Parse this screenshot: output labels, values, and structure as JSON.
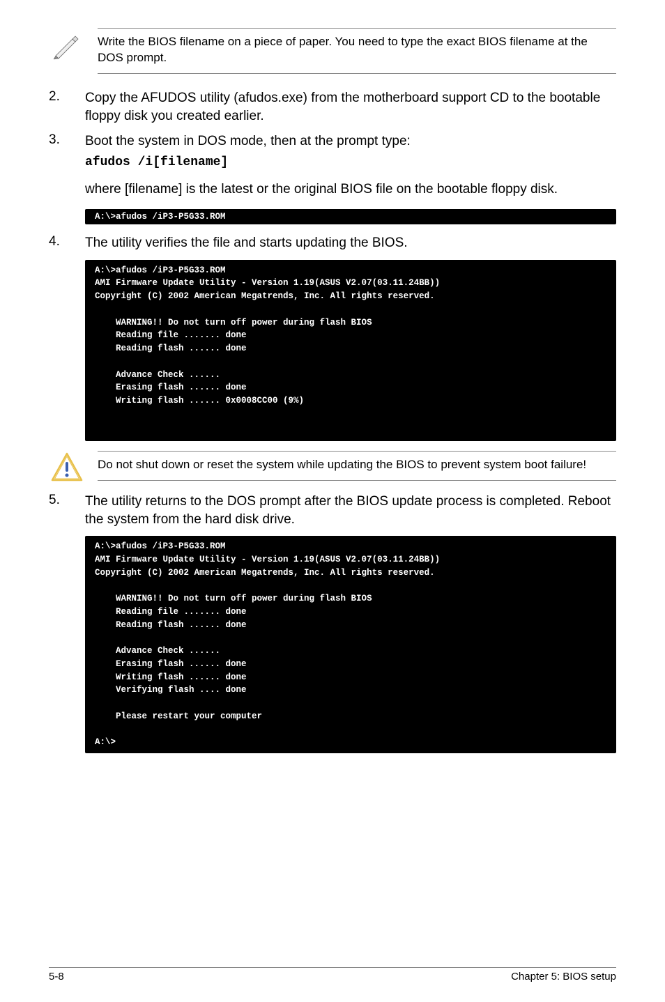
{
  "note1": "Write the BIOS filename on a piece of paper. You need to type the exact BIOS filename at the DOS prompt.",
  "steps": {
    "s2": {
      "num": "2.",
      "text": "Copy the AFUDOS utility (afudos.exe) from the motherboard support CD to the bootable floppy disk you created earlier."
    },
    "s3": {
      "num": "3.",
      "text": "Boot the system in DOS mode, then at the prompt type:",
      "code": "afudos /i[filename]"
    },
    "s4": {
      "num": "4.",
      "text": "The utility verifies the file and starts updating the BIOS."
    },
    "s5": {
      "num": "5.",
      "text": "The utility returns to the DOS prompt after the BIOS update process is completed. Reboot the system from the hard disk drive."
    }
  },
  "para1": "where [filename] is the latest or the original BIOS file on the bootable floppy disk.",
  "term1": "A:\\>afudos /iP3-P5G33.ROM",
  "term2": "A:\\>afudos /iP3-P5G33.ROM\nAMI Firmware Update Utility - Version 1.19(ASUS V2.07(03.11.24BB))\nCopyright (C) 2002 American Megatrends, Inc. All rights reserved.\n\n    WARNING!! Do not turn off power during flash BIOS\n    Reading file ....... done\n    Reading flash ...... done\n\n    Advance Check ......\n    Erasing flash ...... done\n    Writing flash ...... 0x0008CC00 (9%)",
  "warn1": "Do not shut down or reset the system while updating the BIOS to prevent system boot failure!",
  "term3": "A:\\>afudos /iP3-P5G33.ROM\nAMI Firmware Update Utility - Version 1.19(ASUS V2.07(03.11.24BB))\nCopyright (C) 2002 American Megatrends, Inc. All rights reserved.\n\n    WARNING!! Do not turn off power during flash BIOS\n    Reading file ....... done\n    Reading flash ...... done\n\n    Advance Check ......\n    Erasing flash ...... done\n    Writing flash ...... done\n    Verifying flash .... done\n\n    Please restart your computer\n\nA:\\>",
  "footer": {
    "left": "5-8",
    "right": "Chapter 5: BIOS setup"
  }
}
